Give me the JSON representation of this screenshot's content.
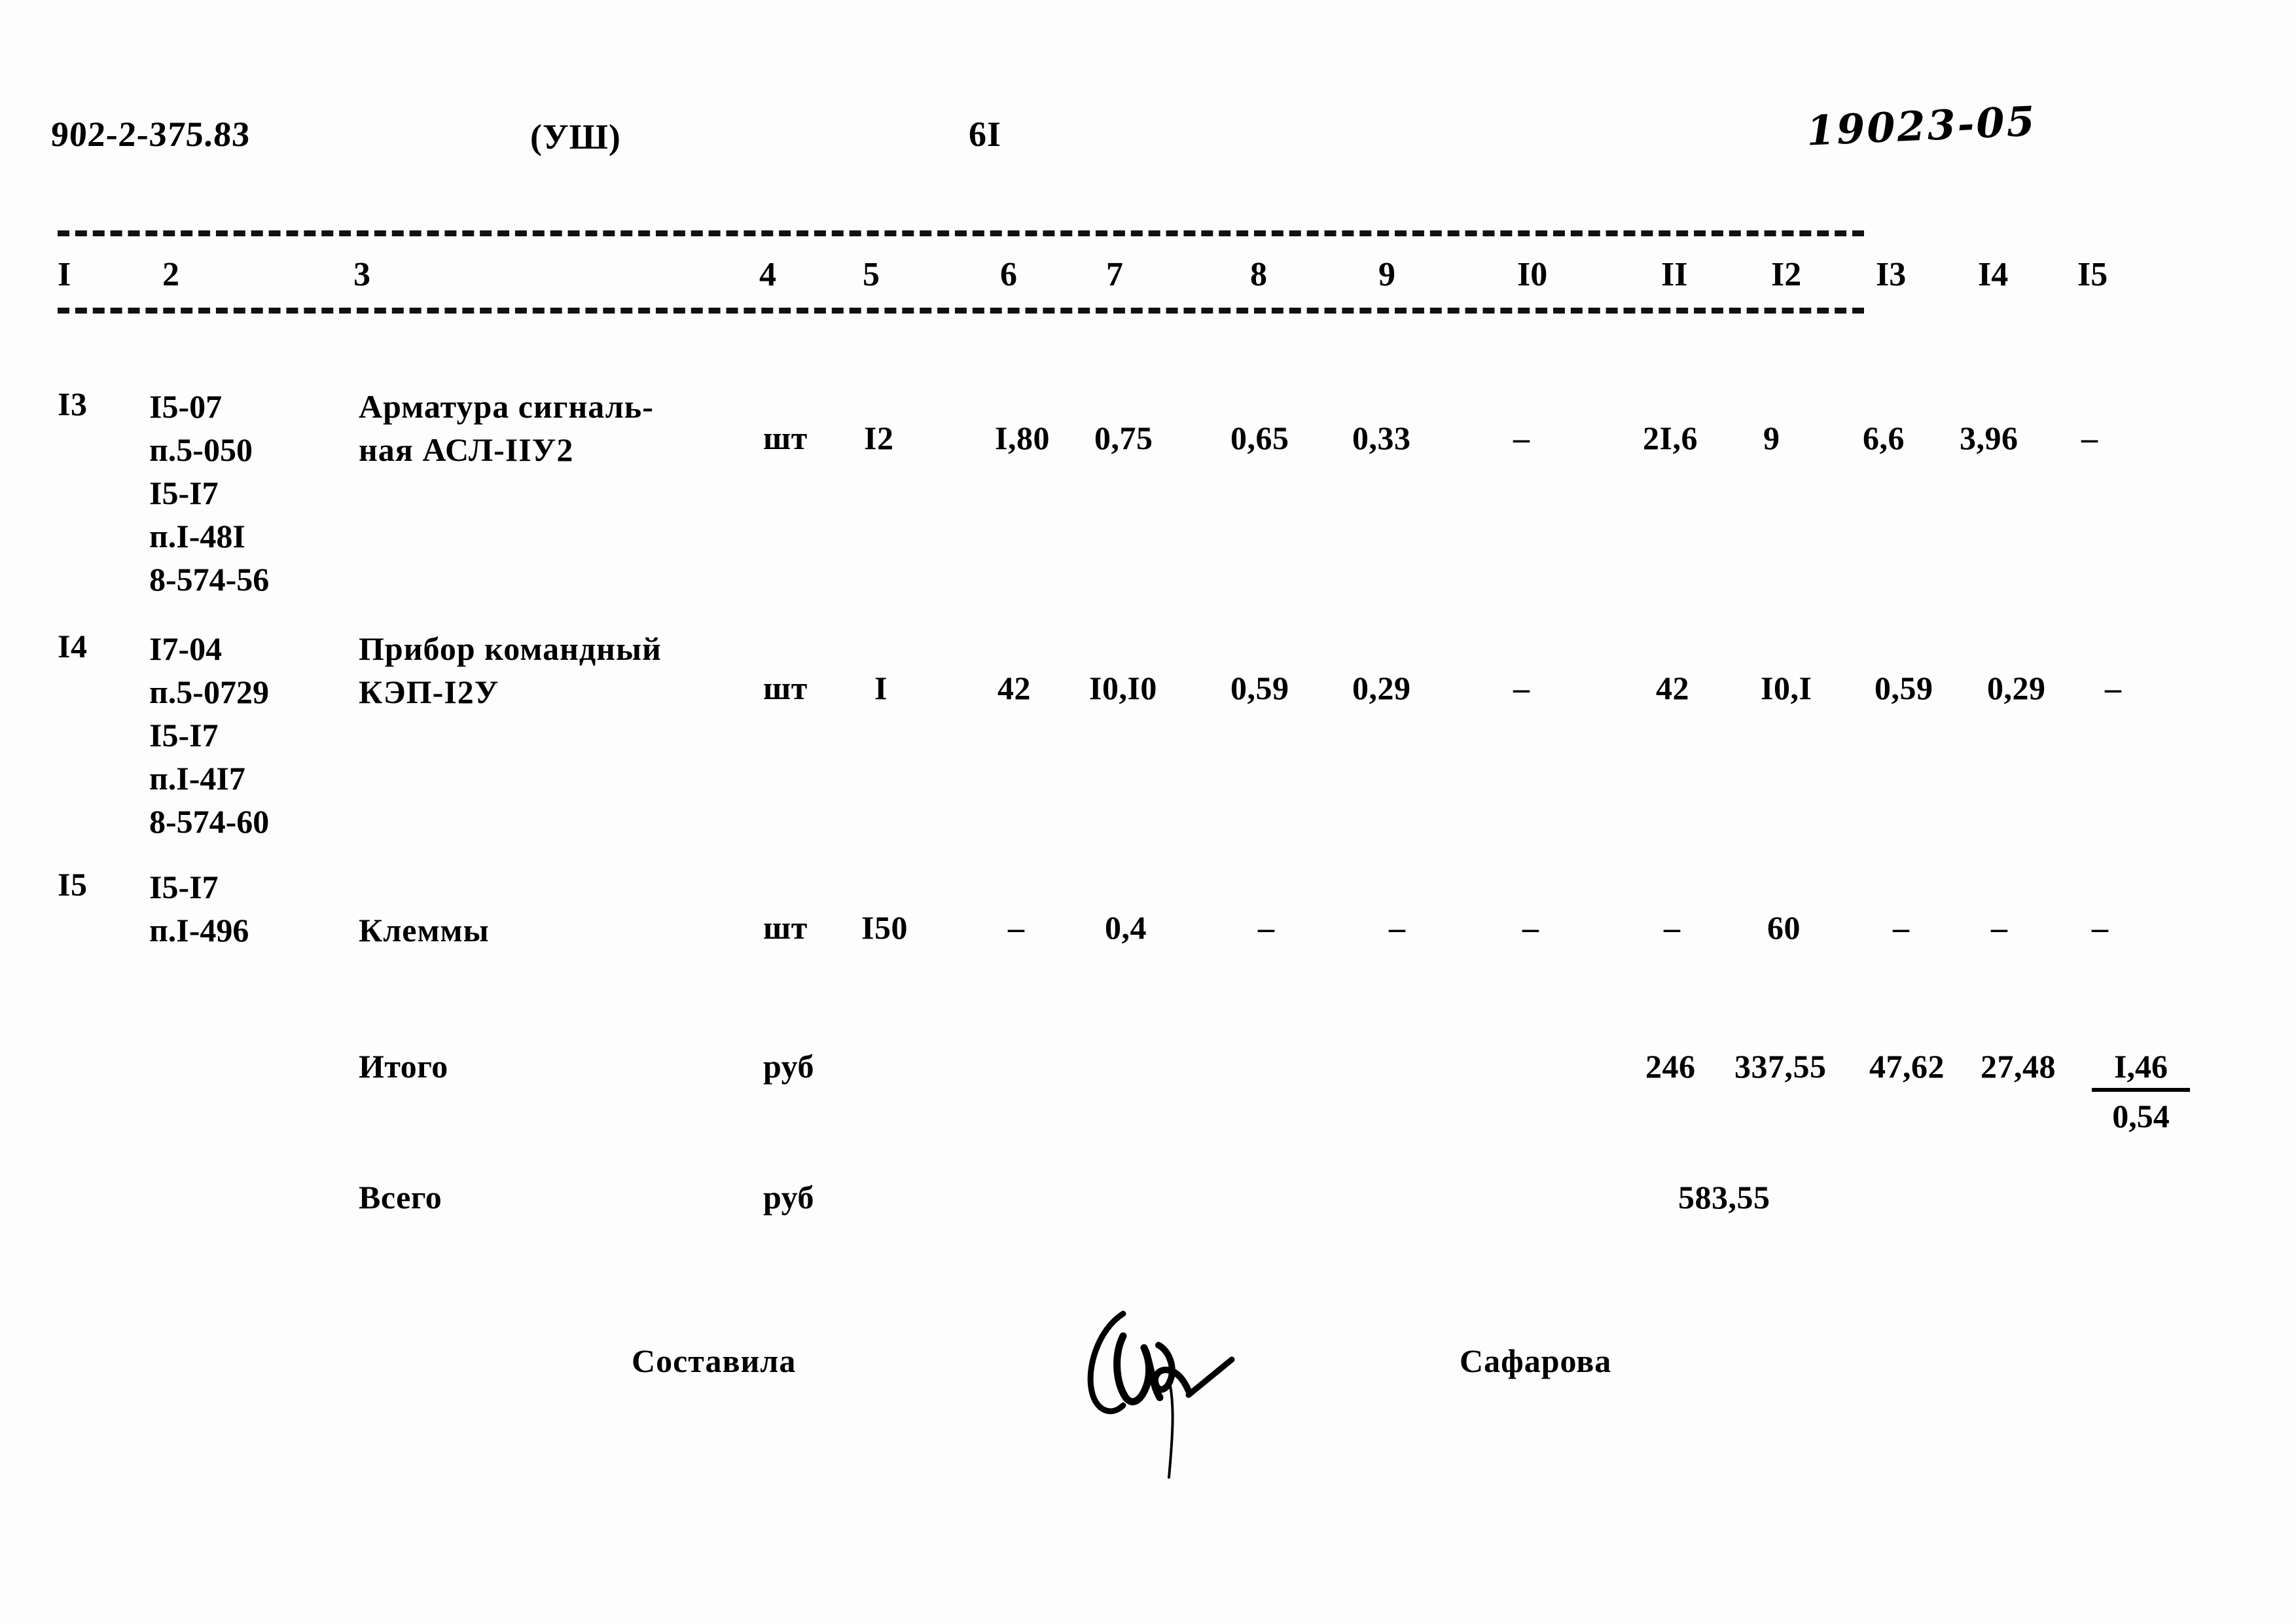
{
  "header": {
    "album_code": "902-2-375.83",
    "section": "(УШ)",
    "page_number": "6I",
    "hand_code": "19023-05"
  },
  "table": {
    "column_headers": [
      "I",
      "2",
      "3",
      "4",
      "5",
      "6",
      "7",
      "8",
      "9",
      "I0",
      "II",
      "I2",
      "I3",
      "I4",
      "I5"
    ],
    "rows": [
      {
        "num": "I3",
        "codes": "I5-07\nп.5-050\nI5-I7\nп.I-48I\n8-574-56",
        "name": "Арматура сигналь-\nная АСЛ-IIУ2",
        "unit": "шт",
        "qty": "I2",
        "c6": "I,80",
        "c7": "0,75",
        "c8": "0,65",
        "c9": "0,33",
        "c10": "–",
        "c11": "2I,6",
        "c12": "9",
        "c13": "6,6",
        "c14": "3,96",
        "c15": "–"
      },
      {
        "num": "I4",
        "codes": "I7-04\nп.5-0729\nI5-I7\nп.I-4I7\n8-574-60",
        "name": "Прибор командный\nКЭП-I2У",
        "unit": "шт",
        "qty": "I",
        "c6": "42",
        "c7": "I0,I0",
        "c8": "0,59",
        "c9": "0,29",
        "c10": "–",
        "c11": "42",
        "c12": "I0,I",
        "c13": "0,59",
        "c14": "0,29",
        "c15": "–"
      },
      {
        "num": "I5",
        "codes": "I5-I7\nп.I-496",
        "name": "Клеммы",
        "unit": "шт",
        "qty": "I50",
        "c6": "–",
        "c7": "0,4",
        "c8": "–",
        "c9": "–",
        "c10": "–",
        "c11": "–",
        "c12": "60",
        "c13": "–",
        "c14": "–",
        "c15": "–"
      }
    ],
    "summary": [
      {
        "label": "Итого",
        "unit": "руб",
        "c11": "246",
        "c12": "337,55",
        "c13": "47,62",
        "c14": "27,48",
        "fraction_numerator": "I,46",
        "fraction_denominator": "0,54"
      },
      {
        "label": "Всего",
        "unit": "руб",
        "value": "583,55"
      }
    ]
  },
  "footer": {
    "compiled_by_label": "Составила",
    "compiled_by_name": "Сафарова",
    "signature": "signature-mark"
  }
}
